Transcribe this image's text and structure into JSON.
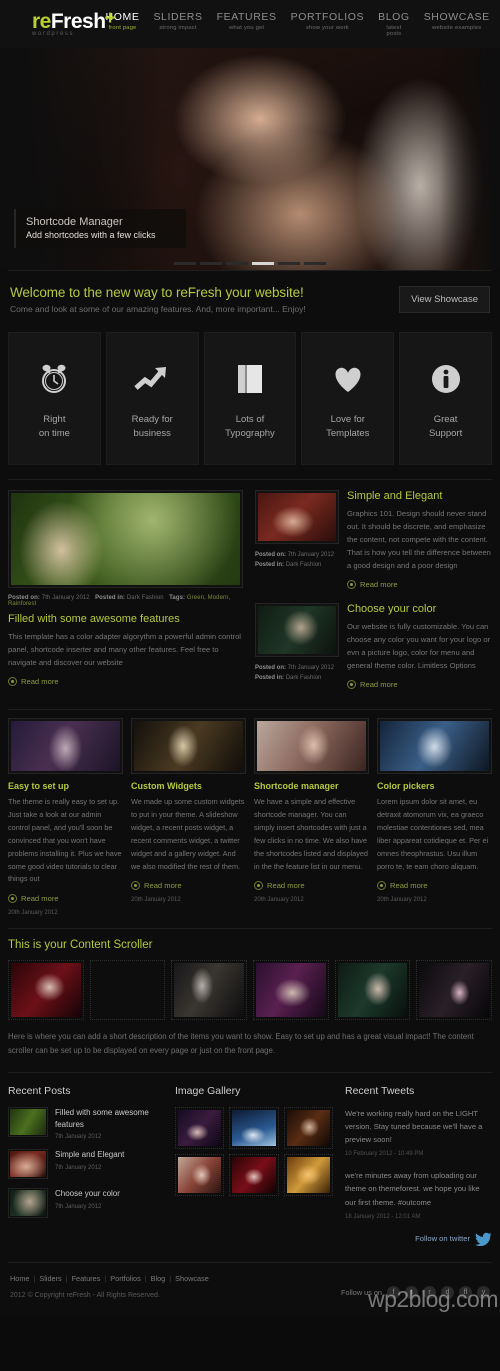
{
  "brand": {
    "logo_re": "re",
    "logo_fresh": "Fresh",
    "logo_plus": "+",
    "logo_sub": "wordpress"
  },
  "nav": {
    "items": [
      {
        "title": "HOME",
        "sub": "front page"
      },
      {
        "title": "SLIDERS",
        "sub": "strong impact"
      },
      {
        "title": "FEATURES",
        "sub": "what you get"
      },
      {
        "title": "PORTFOLIOS",
        "sub": "show your work"
      },
      {
        "title": "BLOG",
        "sub": "latest posts"
      },
      {
        "title": "SHOWCASE",
        "sub": "website examples"
      }
    ]
  },
  "slider": {
    "caption_title": "Shortcode Manager",
    "caption_text": "Add shortcodes with a few clicks"
  },
  "welcome": {
    "heading": "Welcome to the new way to reFresh your website!",
    "subheading": "Come and look at some of our amazing features. And, more important... Enjoy!",
    "button": "View Showcase"
  },
  "features": [
    {
      "icon": "alarm-clock-icon",
      "line1": "Right",
      "line2": "on time"
    },
    {
      "icon": "growth-arrow-icon",
      "line1": "Ready for",
      "line2": "business"
    },
    {
      "icon": "book-icon",
      "line1": "Lots of",
      "line2": "Typography"
    },
    {
      "icon": "heart-icon",
      "line1": "Love for",
      "line2": "Templates"
    },
    {
      "icon": "info-circle-icon",
      "line1": "Great",
      "line2": "Support"
    }
  ],
  "blog": {
    "main_post": {
      "meta_posted_on_label": "Posted on:",
      "meta_posted_on": "7th January 2012",
      "meta_posted_in_label": "Posted in:",
      "meta_posted_in": "Dark Fashion",
      "meta_tags_label": "Tags:",
      "meta_tags": "Green, Modern, Rainforest",
      "title": "Filled with some awesome features",
      "body": "This template has a color adapter algorythm a powerful admin control panel, shortcode inserter and many other features. Feel free to navigate and discover our website",
      "read_more": "Read more"
    },
    "side_posts": [
      {
        "title": "Simple and Elegant",
        "body": "Graphics 101. Design should never stand out. It should be discrete, and emphasize the content, not compete with the content. That is how you tell the difference between a good design and a poor design",
        "meta_posted_on_label": "Posted on:",
        "meta_posted_on": "7th January 2012",
        "meta_posted_in_label": "Posted in:",
        "meta_posted_in": "Dark Fashion",
        "read_more": "Read more"
      },
      {
        "title": "Choose your color",
        "body": "Our website is fully customizable. You can choose any color you want for your logo or evn a picture logo, color for menu and general theme color. Limitless Options",
        "meta_posted_on_label": "Posted on:",
        "meta_posted_on": "7th January 2012",
        "meta_posted_in_label": "Posted in:",
        "meta_posted_in": "Dark Fashion",
        "read_more": "Read more"
      }
    ]
  },
  "portfolio": [
    {
      "title": "Easy to set up",
      "body": "The theme is really easy to set up. Just take a look at our admin control panel, and you'll soon be convinced that you won't have problems installing it. Plus we have some good video tutorials to clear things out",
      "read_more": "Read more",
      "date": "20th January 2012"
    },
    {
      "title": "Custom Widgets",
      "body": "We made up some custom widgets to put in your theme. A slideshow widget, a recent posts widget, a recent comments widget, a twitter widget and a gallery widget. And we also modified the rest of them.",
      "read_more": "Read more",
      "date": "20th January 2012"
    },
    {
      "title": "Shortcode manager",
      "body": "We have a simple and effective shortcode manager. You can simply insert shortcodes with just a few clicks in no time. We also have the shortcodes listed and displayed in the the feature list in our menu.",
      "read_more": "Read more",
      "date": "20th January 2012"
    },
    {
      "title": "Color pickers",
      "body": "Lorem ipsum dolor sit amet, eu detraxit atomorum vix, ea graeco molestiae contentiones sed, mea liber appareat cotidieque et. Per ei omnes theophrastus. Usu illum porro te, te eam choro aliquam.",
      "read_more": "Read more",
      "date": "20th January 2012"
    }
  ],
  "scroller": {
    "heading": "This is your Content Scroller",
    "description": "Here is where you can add a short description of the items you want to show. Easy to set up and has a great visual impact! The content scroller can be set up to be displayed on every page or just on the front page.",
    "items": [
      "scroller-thumb-1",
      "scroller-thumb-2",
      "scroller-thumb-3",
      "scroller-thumb-4",
      "scroller-thumb-5",
      "scroller-thumb-6"
    ]
  },
  "widgets": {
    "recent_posts": {
      "heading": "Recent Posts",
      "items": [
        {
          "title": "Filled with some awesome features",
          "date": "7th January 2012"
        },
        {
          "title": "Simple and Elegant",
          "date": "7th January 2012"
        },
        {
          "title": "Choose your color",
          "date": "7th January 2012"
        }
      ]
    },
    "gallery": {
      "heading": "Image Gallery",
      "items": [
        "gallery-thumb-1",
        "gallery-thumb-2",
        "gallery-thumb-3",
        "gallery-thumb-4",
        "gallery-thumb-5",
        "gallery-thumb-6"
      ]
    },
    "tweets": {
      "heading": "Recent Tweets",
      "items": [
        {
          "text": "We're working really hard on the LIGHT version. Stay tuned because we'll have a preview soon!",
          "date": "10 February 2012 - 10:49 PM"
        },
        {
          "text": "we're minutes away from uploading our theme on themeforest. we hope you like our first theme. #outcome",
          "date": "18 January 2012 - 12:01 AM"
        }
      ],
      "follow_label": "Follow on twitter",
      "follow_icon": "twitter-bird-icon"
    }
  },
  "footer": {
    "links": [
      "Home",
      "Sliders",
      "Features",
      "Portfolios",
      "Blog",
      "Showcase"
    ],
    "separator": "|",
    "copyright": "2012 © Copyright reFresh - All Rights Reserved.",
    "follow_label": "Follow us on",
    "social": [
      {
        "name": "facebook-icon",
        "glyph": "f"
      },
      {
        "name": "twitter-icon",
        "glyph": "t"
      },
      {
        "name": "rss-icon",
        "glyph": "r"
      },
      {
        "name": "dribbble-icon",
        "glyph": "d"
      },
      {
        "name": "flickr-icon",
        "glyph": "fl"
      },
      {
        "name": "youtube-icon",
        "glyph": "y"
      }
    ]
  },
  "watermark": "wp2blog.com"
}
